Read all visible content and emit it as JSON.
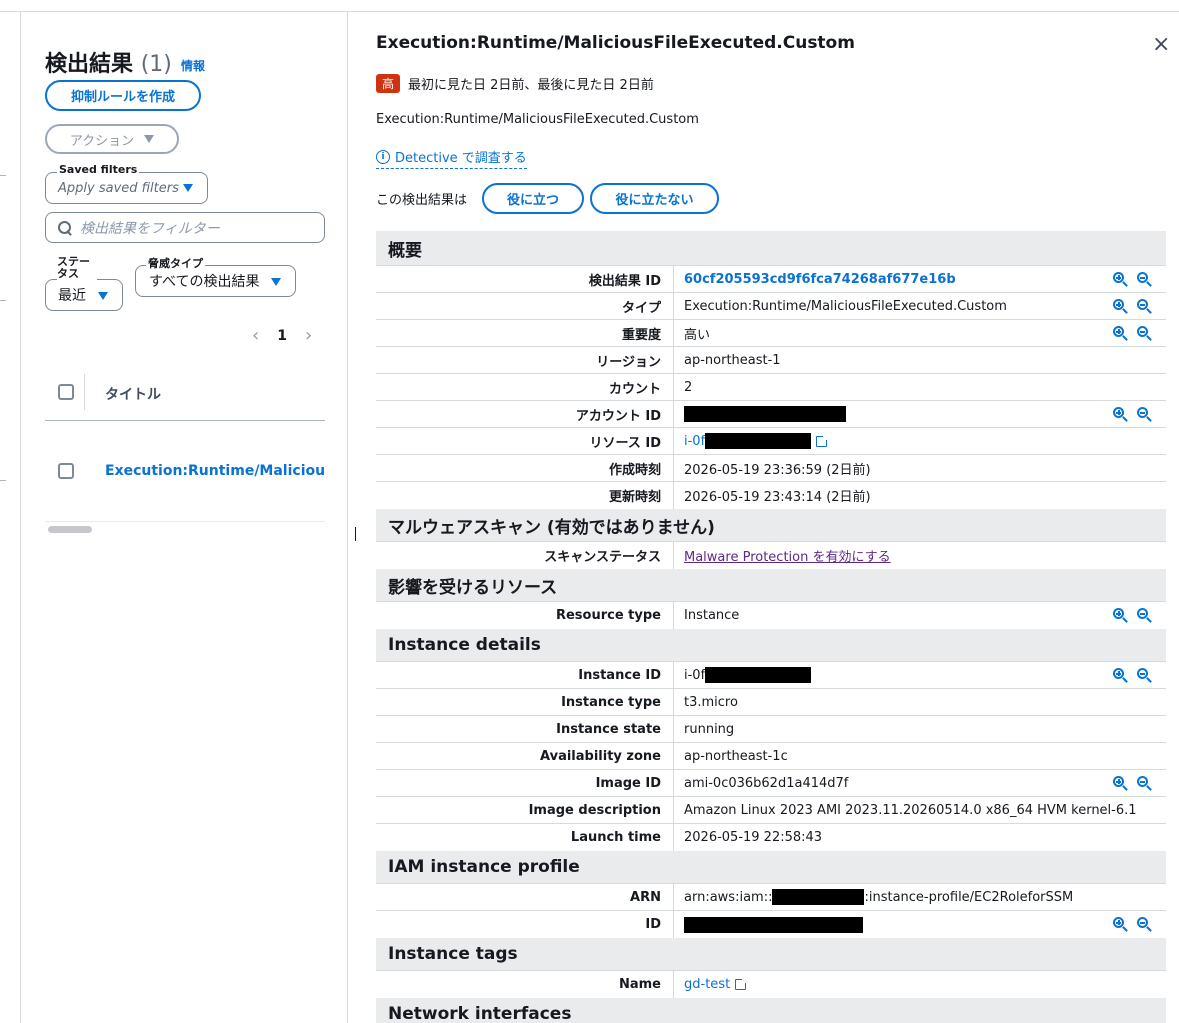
{
  "left": {
    "title": "検出結果",
    "count": "(1)",
    "info": "情報",
    "suppress_button": "抑制ルールを作成",
    "action_button": "アクション",
    "saved_filters_label": "Saved filters",
    "saved_filters_placeholder": "Apply saved filters",
    "search_placeholder": "検出結果をフィルター",
    "status_label": "ステータス",
    "status_value": "最近",
    "threat_label": "脅威タイプ",
    "threat_value": "すべての検出結果",
    "page": "1",
    "col_title": "タイトル",
    "row_title": "Execution:Runtime/MaliciousFileExecuted.Custom"
  },
  "detail": {
    "title": "Execution:Runtime/MaliciousFileExecuted.Custom",
    "close": "×",
    "severity_badge": "高",
    "seen_text": "最初に見た日 2日前、最後に見た日 2日前",
    "type_line": "Execution:Runtime/MaliciousFileExecuted.Custom",
    "detective_link": "Detective で調査する",
    "feedback_label": "この検出結果は",
    "useful": "役に立つ",
    "not_useful": "役に立たない"
  },
  "sections": {
    "overview": "概要",
    "malware": "マルウェアスキャン (有効ではありません)",
    "affected": "影響を受けるリソース",
    "instance": "Instance details",
    "iam": "IAM instance profile",
    "tags": "Instance tags",
    "network": "Network interfaces"
  },
  "overview_rows": {
    "finding_id_k": "検出結果 ID",
    "finding_id_v": "60cf205593cd9f6fca74268af677e16b",
    "type_k": "タイプ",
    "type_v": "Execution:Runtime/MaliciousFileExecuted.Custom",
    "severity_k": "重要度",
    "severity_v": "高い",
    "region_k": "リージョン",
    "region_v": "ap-northeast-1",
    "count_k": "カウント",
    "count_v": "2",
    "account_k": "アカウント ID",
    "resource_k": "リソース ID",
    "resource_prefix": "i-0f",
    "created_k": "作成時刻",
    "created_v": "2026-05-19 23:36:59 (2日前)",
    "updated_k": "更新時刻",
    "updated_v": "2026-05-19 23:43:14 (2日前)"
  },
  "malware_rows": {
    "scan_k": "スキャンステータス",
    "scan_v": "Malware Protection を有効にする"
  },
  "affected_rows": {
    "rtype_k": "Resource type",
    "rtype_v": "Instance"
  },
  "instance_rows": {
    "iid_k": "Instance ID",
    "iid_prefix": "i-0f",
    "itype_k": "Instance type",
    "itype_v": "t3.micro",
    "istate_k": "Instance state",
    "istate_v": "running",
    "az_k": "Availability zone",
    "az_v": "ap-northeast-1c",
    "ami_k": "Image ID",
    "ami_v": "ami-0c036b62d1a414d7f",
    "imgdesc_k": "Image description",
    "imgdesc_v": "Amazon Linux 2023 AMI 2023.11.20260514.0 x86_64 HVM kernel-6.1",
    "launch_k": "Launch time",
    "launch_v": "2026-05-19 22:58:43"
  },
  "iam_rows": {
    "arn_k": "ARN",
    "arn_prefix": "arn:aws:iam::",
    "arn_suffix": ":instance-profile/EC2RoleforSSM",
    "id_k": "ID"
  },
  "tag_rows": {
    "name_k": "Name",
    "name_v": "gd-test"
  }
}
